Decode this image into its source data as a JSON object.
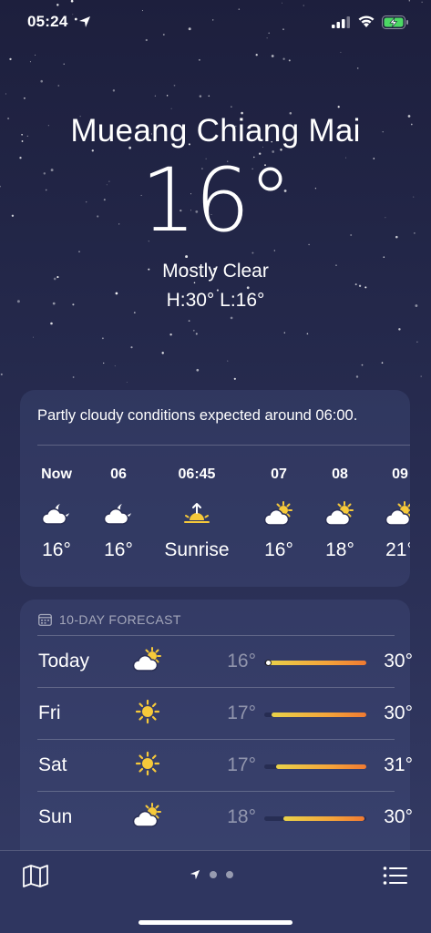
{
  "status_bar": {
    "time": "05:24"
  },
  "location": {
    "city": "Mueang Chiang Mai",
    "temperature": "16°",
    "condition": "Mostly Clear",
    "high_low": "H:30°  L:16°"
  },
  "hourly": {
    "summary": "Partly cloudy conditions expected around 06:00.",
    "items": [
      {
        "time": "Now",
        "icon": "partly-cloudy-night-icon",
        "value": "16°"
      },
      {
        "time": "06",
        "icon": "partly-cloudy-night-icon",
        "value": "16°"
      },
      {
        "time": "06:45",
        "icon": "sunrise-icon",
        "value": "Sunrise"
      },
      {
        "time": "07",
        "icon": "partly-cloudy-day-icon",
        "value": "16°"
      },
      {
        "time": "08",
        "icon": "partly-cloudy-day-icon",
        "value": "18°"
      },
      {
        "time": "09",
        "icon": "partly-cloudy-day-icon",
        "value": "21°"
      }
    ]
  },
  "forecast": {
    "title": "10-DAY FORECAST",
    "days": [
      {
        "day": "Today",
        "icon": "partly-cloudy-day-icon",
        "low": "16°",
        "high": "30°",
        "range_start": 0.02,
        "range_end": 1.0,
        "current": 0.02
      },
      {
        "day": "Fri",
        "icon": "sun-icon",
        "low": "17°",
        "high": "30°",
        "range_start": 0.07,
        "range_end": 1.0
      },
      {
        "day": "Sat",
        "icon": "sun-icon",
        "low": "17°",
        "high": "31°",
        "range_start": 0.12,
        "range_end": 1.03
      },
      {
        "day": "Sun",
        "icon": "partly-cloudy-day-icon",
        "low": "18°",
        "high": "30°",
        "range_start": 0.19,
        "range_end": 0.98
      }
    ]
  },
  "colors": {
    "sun": "#f6c93a",
    "bar_cool": "#e9d24a",
    "bar_warm": "#f07a32",
    "battery": "#4cd964"
  },
  "pager": {
    "pages": 3,
    "current_is_location": true
  }
}
